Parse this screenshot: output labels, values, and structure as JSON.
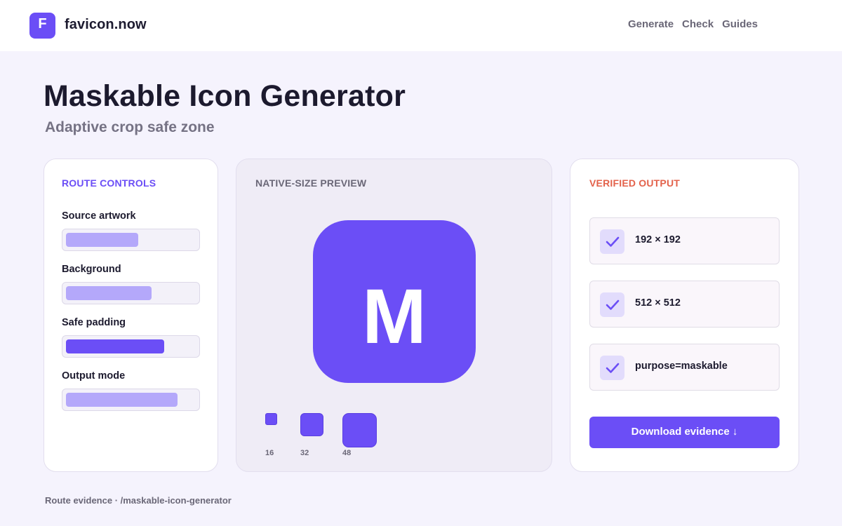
{
  "header": {
    "logo_letter": "F",
    "brand": "favicon.now",
    "nav": [
      "Generate",
      "Check",
      "Guides"
    ]
  },
  "page": {
    "title": "Maskable Icon Generator",
    "subtitle": "Adaptive crop safe zone"
  },
  "controls": {
    "heading": "ROUTE CONTROLS",
    "items": [
      {
        "label": "Source artwork",
        "level": 0.55
      },
      {
        "label": "Background",
        "level": 0.65
      },
      {
        "label": "Safe padding",
        "level": 0.75
      },
      {
        "label": "Output mode",
        "level": 0.85
      }
    ]
  },
  "preview": {
    "heading": "NATIVE-SIZE PREVIEW",
    "icon_letter": "M",
    "sizes": [
      "16",
      "32",
      "48"
    ]
  },
  "output": {
    "heading": "VERIFIED OUTPUT",
    "items": [
      "192 × 192",
      "512 × 512",
      "purpose=maskable"
    ],
    "download_label": "Download evidence ↓"
  },
  "footer": {
    "note": "Route evidence · /maskable-icon-generator"
  },
  "colors": {
    "accent": "#6b4ef6",
    "accent_light": "#b4a8fa",
    "output_heading": "#e3624b"
  }
}
